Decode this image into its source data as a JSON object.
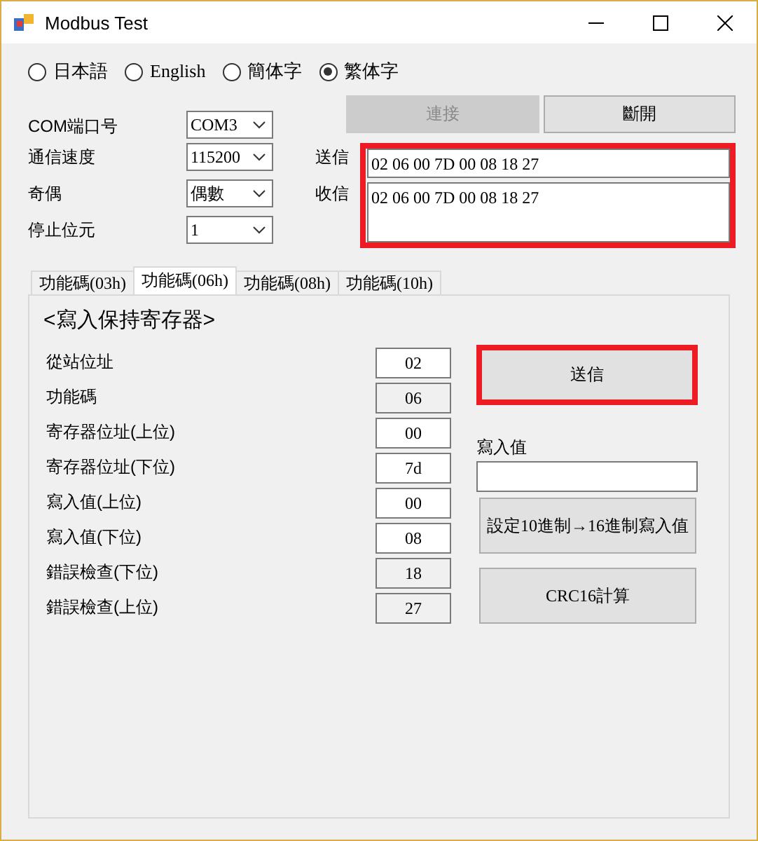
{
  "window": {
    "title": "Modbus Test"
  },
  "languages": [
    {
      "label": "日本語",
      "selected": false
    },
    {
      "label": "English",
      "selected": false
    },
    {
      "label": "簡体字",
      "selected": false
    },
    {
      "label": "繁体字",
      "selected": true
    }
  ],
  "connection_buttons": [
    {
      "label": "連接",
      "disabled": true
    },
    {
      "label": "斷開",
      "disabled": false
    }
  ],
  "settings": [
    {
      "label": "COM端口号",
      "value": "COM3"
    },
    {
      "label": "通信速度",
      "value": "115200"
    },
    {
      "label": "奇偶",
      "value": "偶數"
    },
    {
      "label": "停止位元",
      "value": "1"
    }
  ],
  "messages": {
    "highlighted": true,
    "send": {
      "label": "送信",
      "value": "02 06 00 7D 00 08 18 27"
    },
    "receive": {
      "label": "收信",
      "value": "02 06 00 7D 00 08 18 27"
    }
  },
  "tabs": [
    {
      "label": "功能碼(03h)",
      "selected": false
    },
    {
      "label": "功能碼(06h)",
      "selected": true
    },
    {
      "label": "功能碼(08h)",
      "selected": false
    },
    {
      "label": "功能碼(10h)",
      "selected": false
    }
  ],
  "panel": {
    "heading": "<寫入保持寄存器>",
    "fields": [
      {
        "label": "從站位址",
        "value": "02",
        "readonly": false
      },
      {
        "label": "功能碼",
        "value": "06",
        "readonly": true
      },
      {
        "label": "寄存器位址(上位)",
        "value": "00",
        "readonly": false
      },
      {
        "label": "寄存器位址(下位)",
        "value": "7d",
        "readonly": false
      },
      {
        "label": "寫入值(上位)",
        "value": "00",
        "readonly": false
      },
      {
        "label": "寫入值(下位)",
        "value": "08",
        "readonly": false
      },
      {
        "label": "錯誤檢查(下位)",
        "value": "18",
        "readonly": true
      },
      {
        "label": "錯誤檢查(上位)",
        "value": "27",
        "readonly": true
      }
    ],
    "send_button": {
      "label": "送信",
      "highlighted": true
    },
    "write_value": {
      "label": "寫入值"
    },
    "convert_button": {
      "label": "設定10進制→16進制寫入值"
    },
    "crc_button": {
      "label": "CRC16計算"
    }
  }
}
